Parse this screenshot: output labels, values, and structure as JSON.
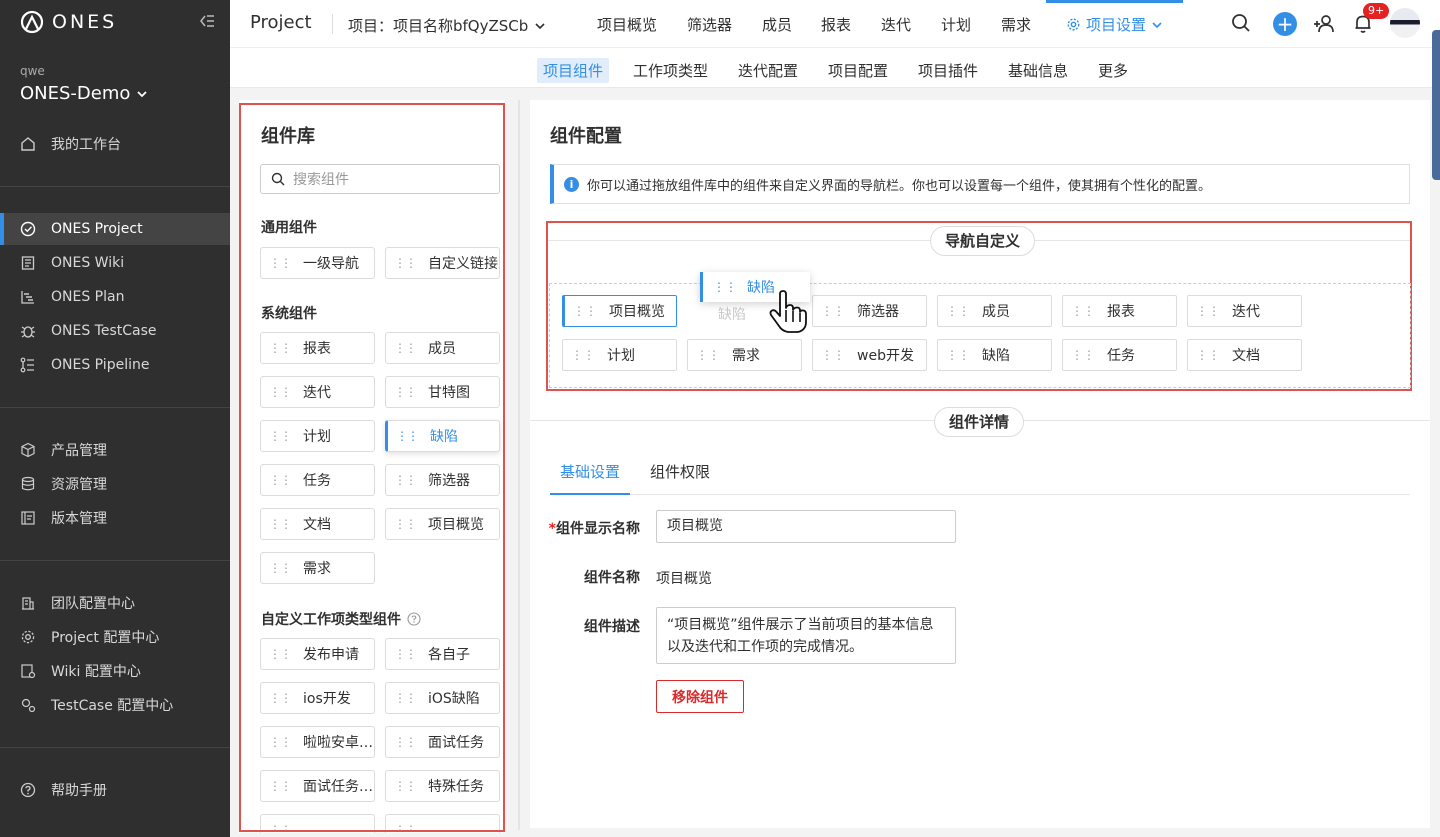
{
  "app": {
    "logo_text": "ONES"
  },
  "sidebar": {
    "org_small": "qwe",
    "org_name": "ONES-Demo",
    "items": [
      {
        "label": "我的工作台"
      },
      {
        "label": "ONES Project"
      },
      {
        "label": "ONES Wiki"
      },
      {
        "label": "ONES Plan"
      },
      {
        "label": "ONES TestCase"
      },
      {
        "label": "ONES Pipeline"
      },
      {
        "label": "产品管理"
      },
      {
        "label": "资源管理"
      },
      {
        "label": "版本管理"
      },
      {
        "label": "团队配置中心"
      },
      {
        "label": "Project 配置中心"
      },
      {
        "label": "Wiki 配置中心"
      },
      {
        "label": "TestCase 配置中心"
      },
      {
        "label": "帮助手册"
      }
    ]
  },
  "topbar": {
    "title": "Project",
    "project_select": "项目：项目名称bfQyZSCb",
    "nav": [
      "项目概览",
      "筛选器",
      "成员",
      "报表",
      "迭代",
      "计划",
      "需求",
      "项目设置"
    ],
    "badge": "9+"
  },
  "subnav": [
    "项目组件",
    "工作项类型",
    "迭代配置",
    "项目配置",
    "项目插件",
    "基础信息",
    "更多"
  ],
  "library": {
    "title": "组件库",
    "search_placeholder": "搜索组件",
    "sections": {
      "general": "通用组件",
      "system": "系统组件",
      "custom": "自定义工作项类型组件"
    },
    "general_items": [
      "一级导航",
      "自定义链接"
    ],
    "system_items": [
      "报表",
      "成员",
      "迭代",
      "甘特图",
      "计划",
      "缺陷",
      "任务",
      "筛选器",
      "文档",
      "项目概览",
      "需求"
    ],
    "custom_items": [
      "发布申请",
      "各自子",
      "ios开发",
      "iOS缺陷",
      "啦啦安卓…",
      "面试任务",
      "面试任务…",
      "特殊任务"
    ]
  },
  "config": {
    "title": "组件配置",
    "info": "你可以通过拖放组件库中的组件来自定义界面的导航栏。你也可以设置每一个组件，使其拥有个性化的配置。",
    "nav_custom_label": "导航自定义",
    "nav_row1": [
      "项目概览",
      "缺陷",
      "筛选器",
      "成员",
      "报表",
      "迭代"
    ],
    "nav_row2": [
      "计划",
      "需求",
      "web开发",
      "缺陷",
      "任务",
      "文档"
    ],
    "dragging_label": "缺陷",
    "detail_label": "组件详情",
    "tabs": [
      "基础设置",
      "组件权限"
    ],
    "form": {
      "display_name_label": "组件显示名称",
      "display_name_value": "项目概览",
      "name_label": "组件名称",
      "name_value": "项目概览",
      "desc_label": "组件描述",
      "desc_value": "“项目概览”组件展示了当前项目的基本信息以及迭代和工作项的完成情况。",
      "remove_button": "移除组件"
    }
  },
  "colors": {
    "accent": "#338fe5",
    "danger": "#e0524d",
    "sidebar_bg": "#2f2f2f"
  }
}
